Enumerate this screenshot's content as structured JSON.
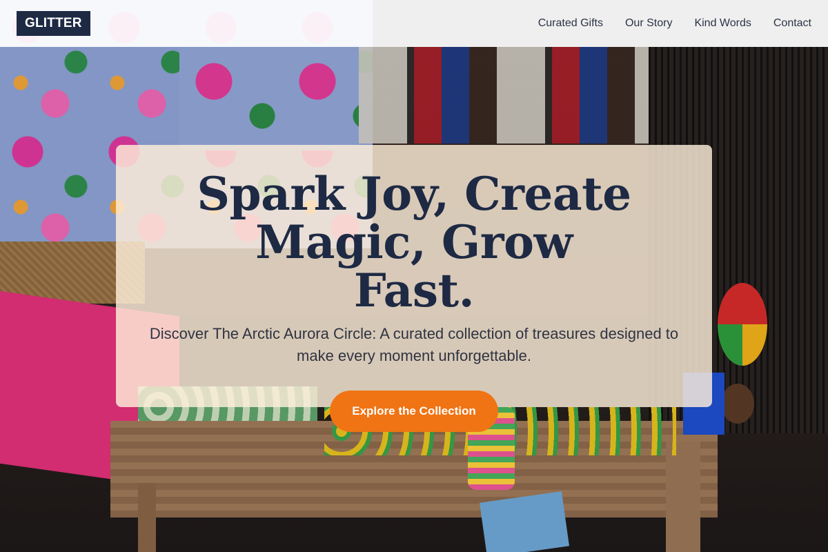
{
  "header": {
    "logo": "GLITTER",
    "nav": [
      {
        "label": "Curated Gifts"
      },
      {
        "label": "Our Story"
      },
      {
        "label": "Kind Words"
      },
      {
        "label": "Contact"
      }
    ]
  },
  "hero": {
    "title": "Spark Joy, Create Magic, Grow Fast.",
    "subtitle": "Discover The Arctic Aurora Circle: A curated collection of treasures designed to make every moment unforgettable.",
    "cta_label": "Explore the Collection"
  },
  "colors": {
    "brand_dark": "#1e2a44",
    "accent": "#f07414",
    "card_bg": "#ffefda"
  },
  "background_image": "market-stall-photo"
}
